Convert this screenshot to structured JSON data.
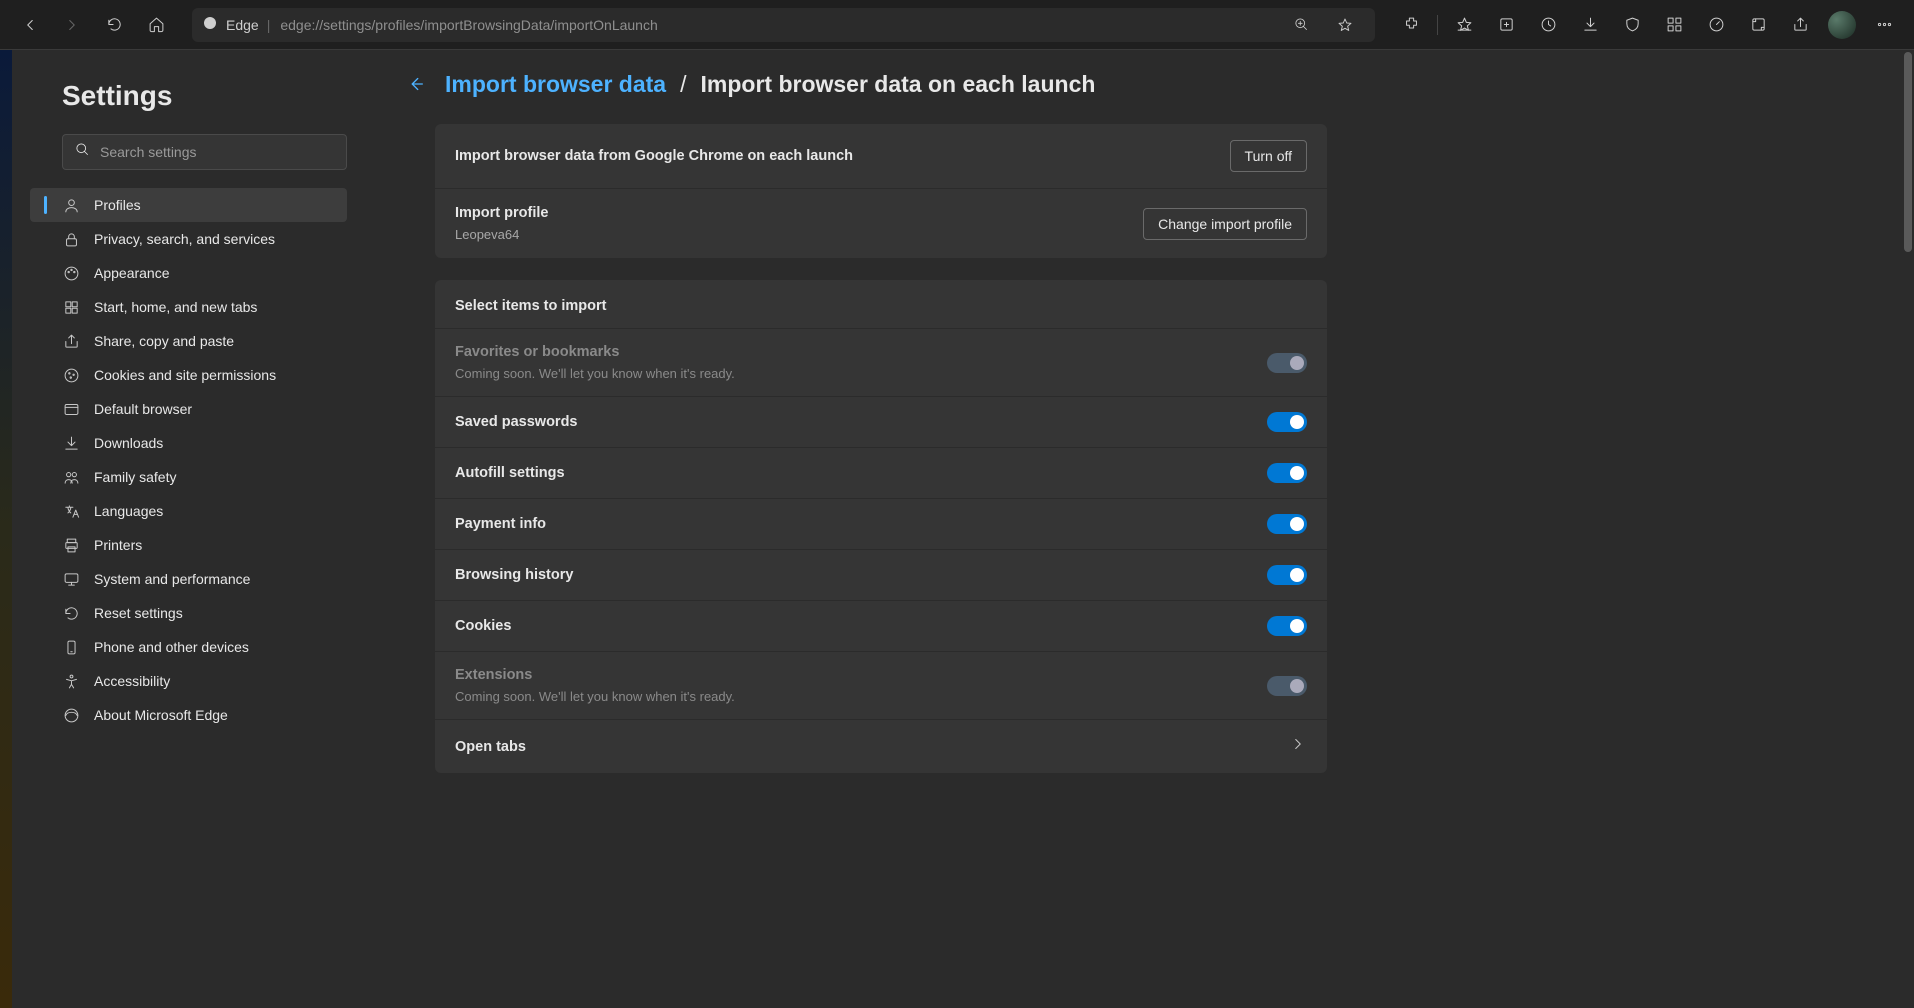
{
  "address": {
    "site_label": "Edge",
    "url": "edge://settings/profiles/importBrowsingData/importOnLaunch"
  },
  "sidebar": {
    "title": "Settings",
    "search_placeholder": "Search settings",
    "items": [
      {
        "label": "Profiles",
        "icon": "user-icon",
        "active": true
      },
      {
        "label": "Privacy, search, and services",
        "icon": "lock-icon"
      },
      {
        "label": "Appearance",
        "icon": "palette-icon"
      },
      {
        "label": "Start, home, and new tabs",
        "icon": "grid-icon"
      },
      {
        "label": "Share, copy and paste",
        "icon": "share-icon"
      },
      {
        "label": "Cookies and site permissions",
        "icon": "cookie-icon"
      },
      {
        "label": "Default browser",
        "icon": "browser-icon"
      },
      {
        "label": "Downloads",
        "icon": "download-icon"
      },
      {
        "label": "Family safety",
        "icon": "family-icon"
      },
      {
        "label": "Languages",
        "icon": "language-icon"
      },
      {
        "label": "Printers",
        "icon": "printer-icon"
      },
      {
        "label": "System and performance",
        "icon": "system-icon"
      },
      {
        "label": "Reset settings",
        "icon": "reset-icon"
      },
      {
        "label": "Phone and other devices",
        "icon": "phone-icon"
      },
      {
        "label": "Accessibility",
        "icon": "accessibility-icon"
      },
      {
        "label": "About Microsoft Edge",
        "icon": "edge-icon"
      }
    ]
  },
  "breadcrumb": {
    "parent": "Import browser data",
    "current": "Import browser data on each launch"
  },
  "import_card": {
    "row1_title": "Import browser data from Google Chrome on each launch",
    "row1_btn": "Turn off",
    "row2_title": "Import profile",
    "row2_sub": "Leopeva64",
    "row2_btn": "Change import profile"
  },
  "select_card": {
    "header": "Select items to import",
    "coming_soon": "Coming soon. We'll let you know when it's ready.",
    "items": [
      {
        "label": "Favorites or bookmarks",
        "state": "disabled",
        "sub": true
      },
      {
        "label": "Saved passwords",
        "state": "on"
      },
      {
        "label": "Autofill settings",
        "state": "on"
      },
      {
        "label": "Payment info",
        "state": "on"
      },
      {
        "label": "Browsing history",
        "state": "on"
      },
      {
        "label": "Cookies",
        "state": "on"
      },
      {
        "label": "Extensions",
        "state": "disabled",
        "sub": true
      },
      {
        "label": "Open tabs",
        "state": "chevron"
      }
    ]
  }
}
